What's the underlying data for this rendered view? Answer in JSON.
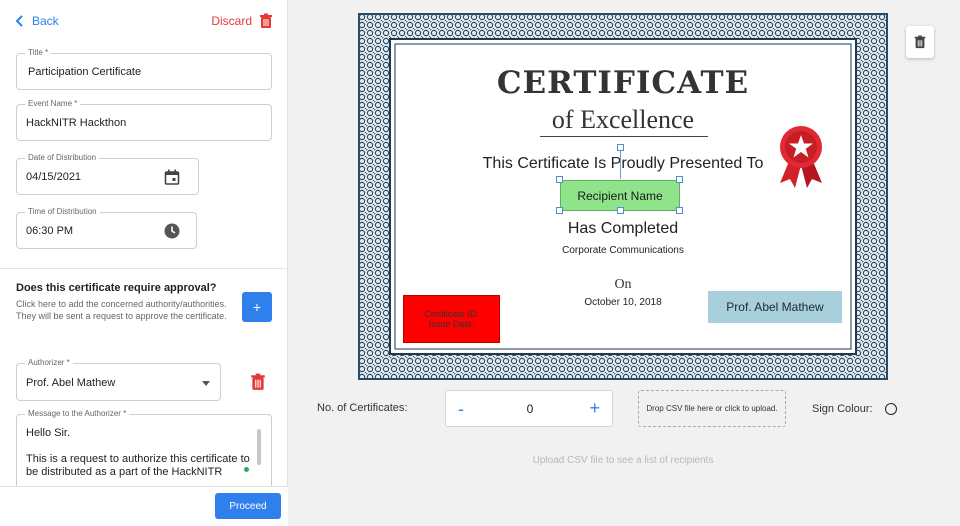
{
  "header": {
    "back_label": "Back",
    "discard_label": "Discard"
  },
  "form": {
    "title": {
      "label": "Title *",
      "value": "Participation Certificate"
    },
    "event_name": {
      "label": "Event Name *",
      "value": "HackNITR Hackthon"
    },
    "date": {
      "label": "Date of Distribution",
      "value": "04/15/2021"
    },
    "time": {
      "label": "Time of Distribution",
      "value": "06:30 PM"
    },
    "approval_question": "Does this certificate require approval?",
    "approval_description": "Click here to add the concerned authority/authorities. They will be sent a request to approve the certificate.",
    "add_authorizer_label": "+",
    "authorizer": {
      "label": "Authorizer *",
      "value": "Prof. Abel Mathew"
    },
    "message": {
      "label": "Message to the Authorizer *",
      "value": "Hello Sir.\n\nThis is a request to authorize this certificate to be distributed as a part of the HackNITR"
    },
    "proceed_label": "Proceed"
  },
  "certificate": {
    "title": "CERTIFICATE",
    "subtitle": "of Excellence",
    "presented": "This Certificate Is Proudly Presented To",
    "recipient_placeholder": "Recipient Name",
    "completed": "Has Completed",
    "course": "Corporate Communications",
    "on": "On",
    "date": "October 10, 2018",
    "cert_id_line1": "Certificate ID:",
    "cert_id_line2": "Issue Date:",
    "signature": "Prof. Abel Mathew"
  },
  "controls": {
    "count_label": "No. of Certificates:",
    "minus": "-",
    "count_value": "0",
    "plus": "+",
    "dropzone": "Drop CSV file here or click to upload.",
    "sign_colour_label": "Sign Colour:",
    "upload_hint": "Upload CSV file to see a list of recipients"
  },
  "colors": {
    "accent": "#2f80ed",
    "danger": "#e53935",
    "recipient_box": "#8fe38b",
    "cert_id_box": "#ff0000",
    "signature_box": "#a7cfdc"
  }
}
